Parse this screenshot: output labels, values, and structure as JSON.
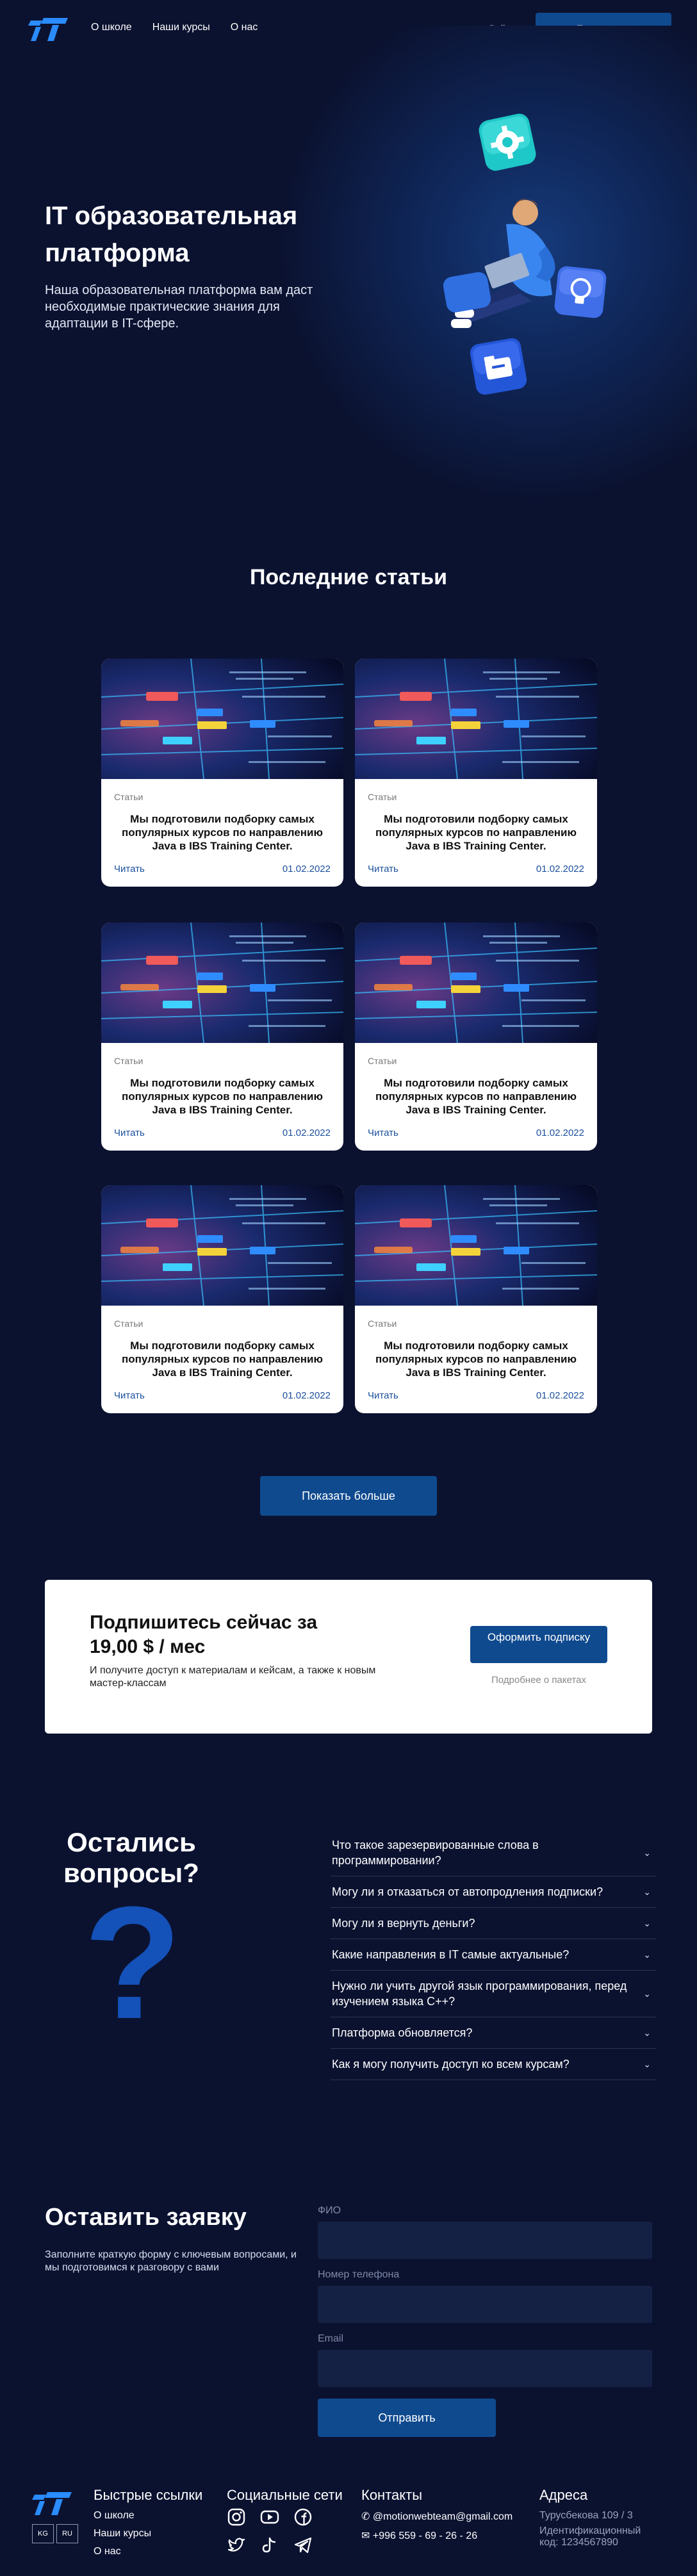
{
  "nav": {
    "logo_text": "IT",
    "links": [
      "О школе",
      "Наши курсы",
      "О нас"
    ],
    "login": "Войти",
    "subscribe": "Подписаться"
  },
  "hero": {
    "title": "IT образовательная платформа",
    "subtitle": "Наша образовательная платформа вам даст необходимые практические знания для адаптации в IT-сфере."
  },
  "articles": {
    "title": "Последние статьи",
    "items": [
      {
        "category": "Статьи",
        "text": "Мы подготовили подборку самых популярных курсов по направлению Java в IBS Training Center.",
        "read": "Читать",
        "date": "01.02.2022"
      },
      {
        "category": "Статьи",
        "text": "Мы подготовили подборку самых популярных курсов по направлению Java в IBS Training Center.",
        "read": "Читать",
        "date": "01.02.2022"
      },
      {
        "category": "Статьи",
        "text": "Мы подготовили подборку самых популярных курсов по направлению Java в IBS Training Center.",
        "read": "Читать",
        "date": "01.02.2022"
      },
      {
        "category": "Статьи",
        "text": "Мы подготовили подборку самых популярных курсов по направлению Java в IBS Training Center.",
        "read": "Читать",
        "date": "01.02.2022"
      },
      {
        "category": "Статьи",
        "text": "Мы подготовили подборку самых популярных курсов по направлению Java в IBS Training Center.",
        "read": "Читать",
        "date": "01.02.2022"
      },
      {
        "category": "Статьи",
        "text": "Мы подготовили подборку самых популярных курсов по направлению Java в IBS Training Center.",
        "read": "Читать",
        "date": "01.02.2022"
      }
    ],
    "show_more": "Показать больше"
  },
  "subscribe": {
    "title": "Подпишитесь сейчас за 19,00 $ / мес",
    "description": "И получите доступ к материалам и кейсам, а также к новым мастер-классам",
    "button": "Оформить подписку",
    "more": "Подробнее о пакетах"
  },
  "faq": {
    "title": "Остались вопросы?",
    "items": [
      "Что такое зарезервированные слова в программировании?",
      "Могу ли я отказаться от автопродления подписки?",
      "Могу ли я вернуть деньги?",
      "Какие направления в IT самые актуальные?",
      "Нужно ли учить другой язык программирования, перед изучением языка С++?",
      "Платформа обновляется?",
      "Как я могу получить доступ ко всем курсам?"
    ]
  },
  "application": {
    "title": "Оставить заявку",
    "description": "Заполните краткую форму с ключевым вопросами, и мы подготовимся к разговору с вами",
    "fields": [
      "ФИО",
      "Номер телефона",
      "Email"
    ],
    "submit": "Отправить"
  },
  "footer": {
    "languages": [
      "KG",
      "RU"
    ],
    "quick_links_title": "Быстрые ссылки",
    "quick_links": [
      "О школе",
      "Наши курсы",
      "О нас"
    ],
    "social_title": "Социальные сети",
    "social_icons": [
      "instagram-icon",
      "youtube-icon",
      "facebook-icon",
      "twitter-icon",
      "tiktok-icon",
      "telegram-icon"
    ],
    "contacts_title": "Контакты",
    "email": "@motionwebteam@gmail.com",
    "phone": "+996 559 - 69 - 26 - 26",
    "address_title": "Адреса",
    "address": "Турусбекова 109 / 3",
    "id_label": "Идентификационный код: 1234567890"
  },
  "colors": {
    "background": "#0b1230",
    "accent": "#0f4a8f",
    "link": "#1a4f9c",
    "logo_blue": "#2a8cff"
  }
}
